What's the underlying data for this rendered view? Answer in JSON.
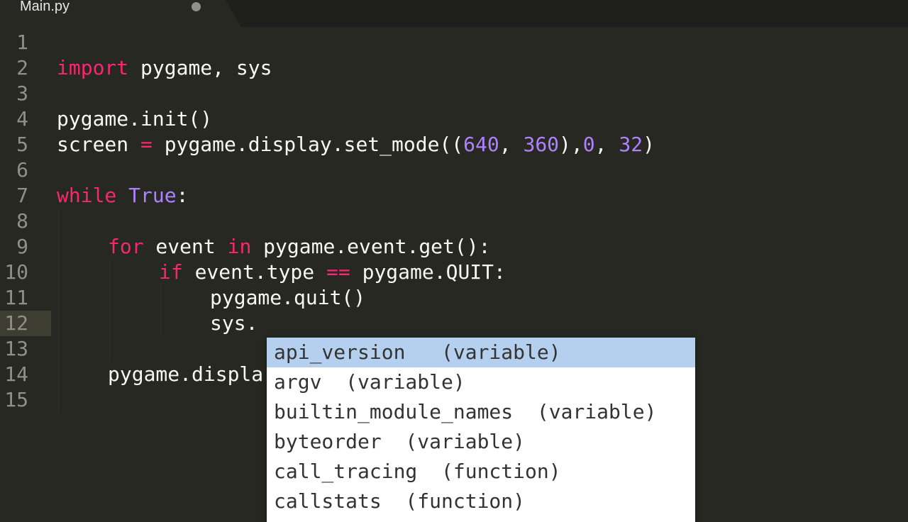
{
  "tab": {
    "title": "Main.py"
  },
  "gutter": {
    "line_numbers": [
      "1",
      "2",
      "3",
      "4",
      "5",
      "6",
      "7",
      "8",
      "9",
      "10",
      "11",
      "12",
      "13",
      "14",
      "15"
    ]
  },
  "code": {
    "l2": {
      "import_kw": "import",
      "rest": " pygame, sys"
    },
    "l4": {
      "text": "pygame.init()"
    },
    "l5": {
      "a": "screen ",
      "eq": "=",
      "b": " pygame.display.set_mode((",
      "n640": "640",
      "c1": ", ",
      "n360": "360",
      "c2": "),",
      "n0": "0",
      "c3": ", ",
      "n32": "32",
      "end": ")"
    },
    "l7": {
      "while_kw": "while",
      "sp": " ",
      "true_const": "True",
      "colon": ":"
    },
    "l9": {
      "for_kw": "for",
      "a": " event ",
      "in_kw": "in",
      "b": " pygame.event.get():"
    },
    "l10": {
      "if_kw": "if",
      "a": " event.type ",
      "eq": "==",
      "b": " pygame.QUIT:"
    },
    "l11": {
      "text": "pygame.quit()"
    },
    "l12": {
      "text": "sys."
    },
    "l14": {
      "text": "pygame.displa"
    }
  },
  "autocomplete": {
    "items": [
      {
        "label": "api_version   (variable)",
        "selected": true
      },
      {
        "label": "argv  (variable)"
      },
      {
        "label": "builtin_module_names  (variable)"
      },
      {
        "label": "byteorder  (variable)"
      },
      {
        "label": "call_tracing  (function)"
      },
      {
        "label": "callstats  (function)"
      }
    ]
  }
}
